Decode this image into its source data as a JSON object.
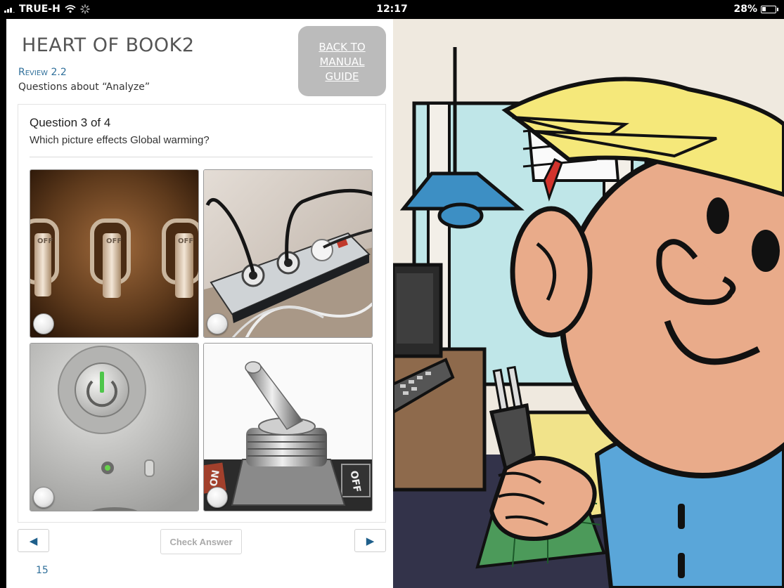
{
  "status_bar": {
    "carrier": "TRUE-H",
    "time": "12:17",
    "battery": "28%",
    "icons": [
      "signal-icon",
      "wifi-icon",
      "loading-icon",
      "battery-icon"
    ]
  },
  "header": {
    "title": "HEART OF BOOK2",
    "review_label": "Review 2.2",
    "review_subtitle": "Questions about “Analyze”",
    "back_button": [
      "BACK TO",
      "MANUAL",
      "GUIDE"
    ]
  },
  "quiz": {
    "question_number": "Question 3 of 4",
    "question_text": "Which picture effects Global warming?",
    "options": [
      {
        "id": "a",
        "image": "light-switches-off-photo",
        "switch_labels": [
          "OFF",
          "OFF",
          "OFF"
        ],
        "selected": false
      },
      {
        "id": "b",
        "image": "power-strip-plugs-photo",
        "selected": false
      },
      {
        "id": "c",
        "image": "power-button-photo",
        "selected": false
      },
      {
        "id": "d",
        "image": "toggle-switch-photo",
        "switch_labels": [
          "ON",
          "OFF"
        ],
        "selected": false
      }
    ]
  },
  "footer": {
    "check_answer": "Check Answer",
    "page_number": "15",
    "prev_icon": "◀",
    "next_icon": "▶"
  },
  "illustration": {
    "subject": "cartoon-boy-holding-plug",
    "colors": {
      "skin": "#e9ab8a",
      "hair": "#f5e87a",
      "lamp": "#3d8fc4",
      "shirt": "#5aa6d9",
      "window": "#bfe6e8"
    }
  },
  "colors": {
    "accent": "#2f6f9a",
    "back_button_bg": "#bbbbbb"
  }
}
